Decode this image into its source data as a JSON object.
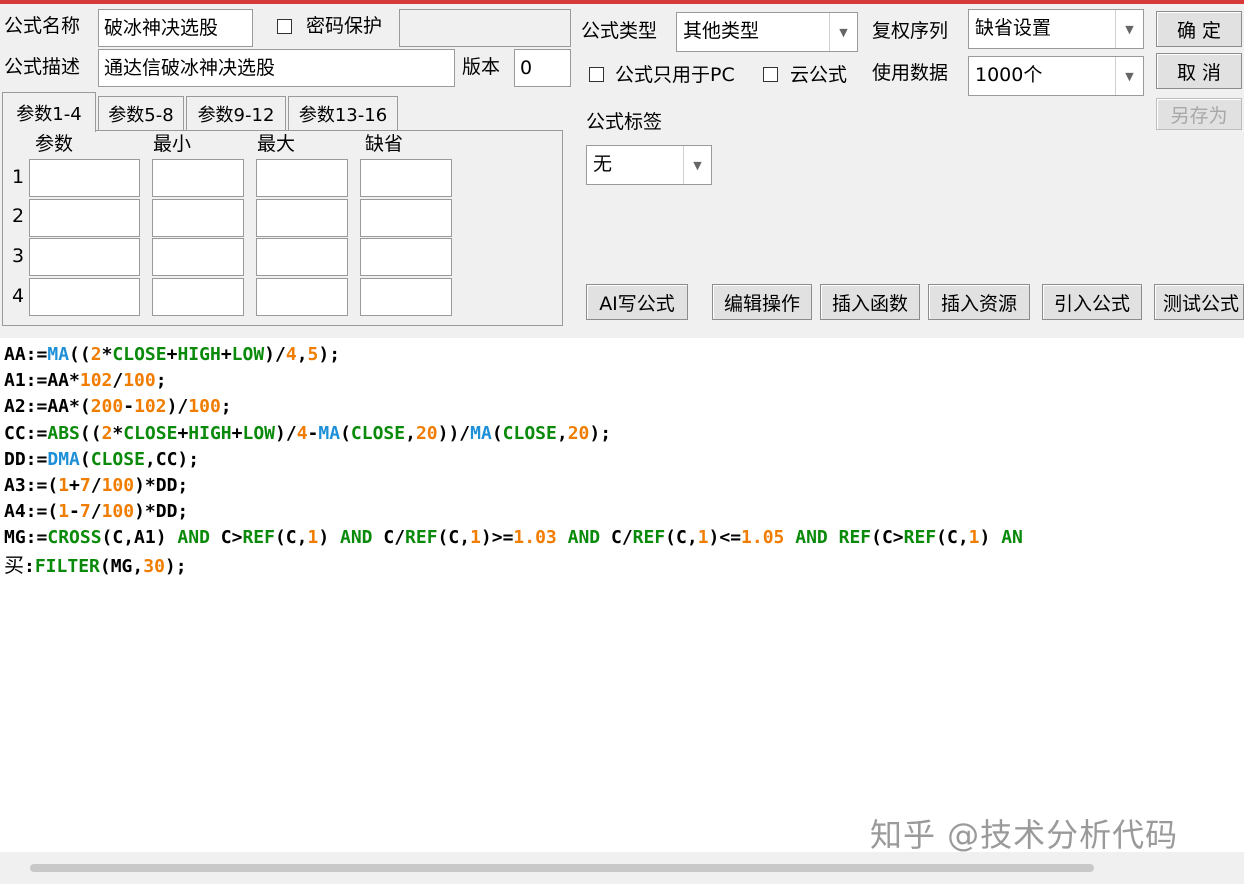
{
  "header": {
    "name_label": "公式名称",
    "name_value": "破冰神决选股",
    "password_label": "密码保护",
    "password_value": "",
    "desc_label": "公式描述",
    "desc_value": "通达信破冰神决选股",
    "version_label": "版本",
    "version_value": "0"
  },
  "options": {
    "type_label": "公式类型",
    "type_value": "其他类型",
    "rights_label": "复权序列",
    "rights_value": "缺省设置",
    "pc_only_label": "公式只用于PC",
    "cloud_label": "云公式",
    "data_label": "使用数据",
    "data_value": "1000个",
    "tag_label": "公式标签",
    "tag_value": "无"
  },
  "buttons": {
    "ok": "确 定",
    "cancel": "取 消",
    "save_as": "另存为",
    "ai": "AI写公式",
    "edit_ops": "编辑操作",
    "insert_func": "插入函数",
    "insert_res": "插入资源",
    "import": "引入公式",
    "test": "测试公式"
  },
  "params": {
    "tabs": [
      "参数1-4",
      "参数5-8",
      "参数9-12",
      "参数13-16"
    ],
    "headers": [
      "参数",
      "最小",
      "最大",
      "缺省"
    ],
    "rows": [
      "1",
      "2",
      "3",
      "4"
    ]
  },
  "code_lines": [
    [
      [
        "AA:=",
        "k"
      ],
      [
        "MA",
        "b"
      ],
      [
        "((",
        "k"
      ],
      [
        "2",
        "o"
      ],
      [
        "*",
        "k"
      ],
      [
        "CLOSE",
        "g"
      ],
      [
        "+",
        "k"
      ],
      [
        "HIGH",
        "g"
      ],
      [
        "+",
        "k"
      ],
      [
        "LOW",
        "g"
      ],
      [
        ")/",
        "k"
      ],
      [
        "4",
        "o"
      ],
      [
        ",",
        "k"
      ],
      [
        "5",
        "o"
      ],
      [
        ");",
        "k"
      ]
    ],
    [
      [
        "A1:=AA*",
        "k"
      ],
      [
        "102",
        "o"
      ],
      [
        "/",
        "k"
      ],
      [
        "100",
        "o"
      ],
      [
        ";",
        "k"
      ]
    ],
    [
      [
        "A2:=AA*(",
        "k"
      ],
      [
        "200",
        "o"
      ],
      [
        "-",
        "k"
      ],
      [
        "102",
        "o"
      ],
      [
        ")/",
        "k"
      ],
      [
        "100",
        "o"
      ],
      [
        ";",
        "k"
      ]
    ],
    [
      [
        "CC:=",
        "k"
      ],
      [
        "ABS",
        "g"
      ],
      [
        "((",
        "k"
      ],
      [
        "2",
        "o"
      ],
      [
        "*",
        "k"
      ],
      [
        "CLOSE",
        "g"
      ],
      [
        "+",
        "k"
      ],
      [
        "HIGH",
        "g"
      ],
      [
        "+",
        "k"
      ],
      [
        "LOW",
        "g"
      ],
      [
        ")/",
        "k"
      ],
      [
        "4",
        "o"
      ],
      [
        "-",
        "k"
      ],
      [
        "MA",
        "b"
      ],
      [
        "(",
        "k"
      ],
      [
        "CLOSE",
        "g"
      ],
      [
        ",",
        "k"
      ],
      [
        "20",
        "o"
      ],
      [
        "))/",
        "k"
      ],
      [
        "MA",
        "b"
      ],
      [
        "(",
        "k"
      ],
      [
        "CLOSE",
        "g"
      ],
      [
        ",",
        "k"
      ],
      [
        "20",
        "o"
      ],
      [
        ");",
        "k"
      ]
    ],
    [
      [
        "DD:=",
        "k"
      ],
      [
        "DMA",
        "b"
      ],
      [
        "(",
        "k"
      ],
      [
        "CLOSE",
        "g"
      ],
      [
        ",CC);",
        "k"
      ]
    ],
    [
      [
        "A3:=(",
        "k"
      ],
      [
        "1",
        "o"
      ],
      [
        "+",
        "k"
      ],
      [
        "7",
        "o"
      ],
      [
        "/",
        "k"
      ],
      [
        "100",
        "o"
      ],
      [
        ")*DD;",
        "k"
      ]
    ],
    [
      [
        "A4:=(",
        "k"
      ],
      [
        "1",
        "o"
      ],
      [
        "-",
        "k"
      ],
      [
        "7",
        "o"
      ],
      [
        "/",
        "k"
      ],
      [
        "100",
        "o"
      ],
      [
        ")*DD;",
        "k"
      ]
    ],
    [
      [
        "MG:=",
        "k"
      ],
      [
        "CROSS",
        "g"
      ],
      [
        "(C,A1) ",
        "k"
      ],
      [
        "AND",
        "g"
      ],
      [
        " C>",
        "k"
      ],
      [
        "REF",
        "g"
      ],
      [
        "(C,",
        "k"
      ],
      [
        "1",
        "o"
      ],
      [
        ") ",
        "k"
      ],
      [
        "AND",
        "g"
      ],
      [
        " C/",
        "k"
      ],
      [
        "REF",
        "g"
      ],
      [
        "(C,",
        "k"
      ],
      [
        "1",
        "o"
      ],
      [
        ")>=",
        "k"
      ],
      [
        "1.03",
        "o"
      ],
      [
        " ",
        "k"
      ],
      [
        "AND",
        "g"
      ],
      [
        " C/",
        "k"
      ],
      [
        "REF",
        "g"
      ],
      [
        "(C,",
        "k"
      ],
      [
        "1",
        "o"
      ],
      [
        ")<=",
        "k"
      ],
      [
        "1.05",
        "o"
      ],
      [
        " ",
        "k"
      ],
      [
        "AND",
        "g"
      ],
      [
        " ",
        "k"
      ],
      [
        "REF",
        "g"
      ],
      [
        "(C>",
        "k"
      ],
      [
        "REF",
        "g"
      ],
      [
        "(C,",
        "k"
      ],
      [
        "1",
        "o"
      ],
      [
        ") ",
        "k"
      ],
      [
        "AN",
        "g"
      ]
    ],
    [
      [
        "买",
        "k"
      ],
      [
        ":",
        "k"
      ],
      [
        "FILTER",
        "g"
      ],
      [
        "(MG,",
        "k"
      ],
      [
        "30",
        "o"
      ],
      [
        ");",
        "k"
      ]
    ]
  ],
  "colors": {
    "k": "#000000",
    "b": "#1e90d8",
    "g": "#0a8a0a",
    "o": "#f07d00"
  },
  "watermark": "知乎 @技术分析代码"
}
